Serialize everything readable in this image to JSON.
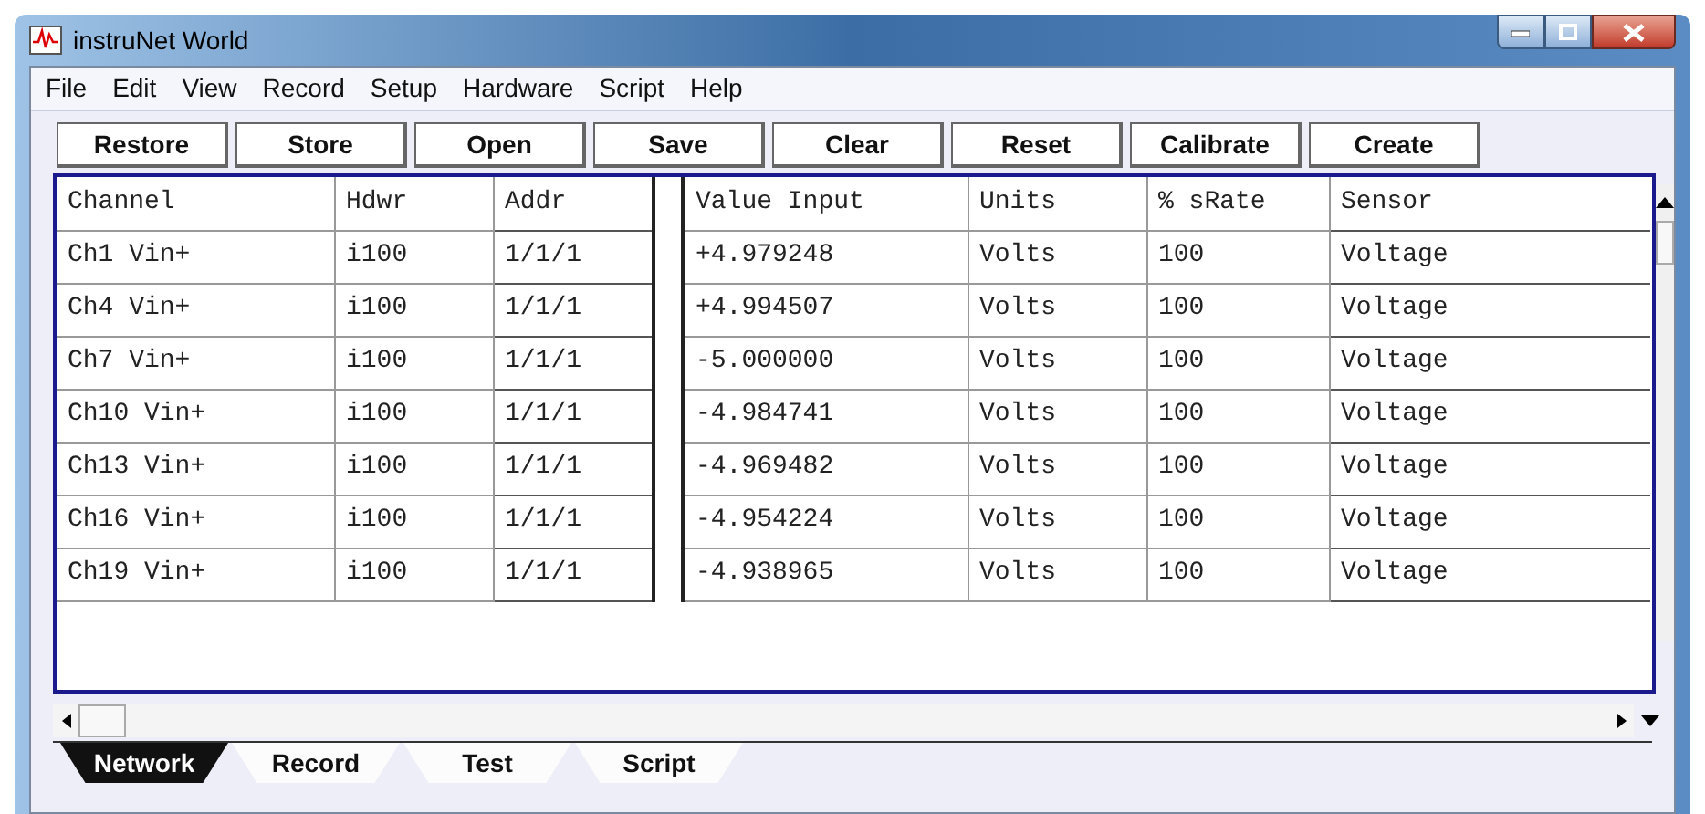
{
  "window": {
    "title": "instruNet World"
  },
  "menu": [
    "File",
    "Edit",
    "View",
    "Record",
    "Setup",
    "Hardware",
    "Script",
    "Help"
  ],
  "toolbar": [
    "Restore",
    "Store",
    "Open",
    "Save",
    "Clear",
    "Reset",
    "Calibrate",
    "Create"
  ],
  "table": {
    "columns": [
      "Channel",
      "Hdwr",
      "Addr",
      "Value Input",
      "Units",
      "% sRate",
      "Sensor"
    ],
    "rows": [
      [
        "Ch1 Vin+",
        "i100",
        "1/1/1",
        "+4.979248",
        "Volts",
        "100",
        "Voltage"
      ],
      [
        "Ch4 Vin+",
        "i100",
        "1/1/1",
        "+4.994507",
        "Volts",
        "100",
        "Voltage"
      ],
      [
        "Ch7 Vin+",
        "i100",
        "1/1/1",
        "-5.000000",
        "Volts",
        "100",
        "Voltage"
      ],
      [
        "Ch10 Vin+",
        "i100",
        "1/1/1",
        "-4.984741",
        "Volts",
        "100",
        "Voltage"
      ],
      [
        "Ch13 Vin+",
        "i100",
        "1/1/1",
        "-4.969482",
        "Volts",
        "100",
        "Voltage"
      ],
      [
        "Ch16 Vin+",
        "i100",
        "1/1/1",
        "-4.954224",
        "Volts",
        "100",
        "Voltage"
      ],
      [
        "Ch19 Vin+",
        "i100",
        "1/1/1",
        "-4.938965",
        "Volts",
        "100",
        "Voltage"
      ]
    ]
  },
  "tabs": [
    {
      "label": "Network",
      "selected": true
    },
    {
      "label": "Record",
      "selected": false
    },
    {
      "label": "Test",
      "selected": false
    },
    {
      "label": "Script",
      "selected": false
    }
  ]
}
